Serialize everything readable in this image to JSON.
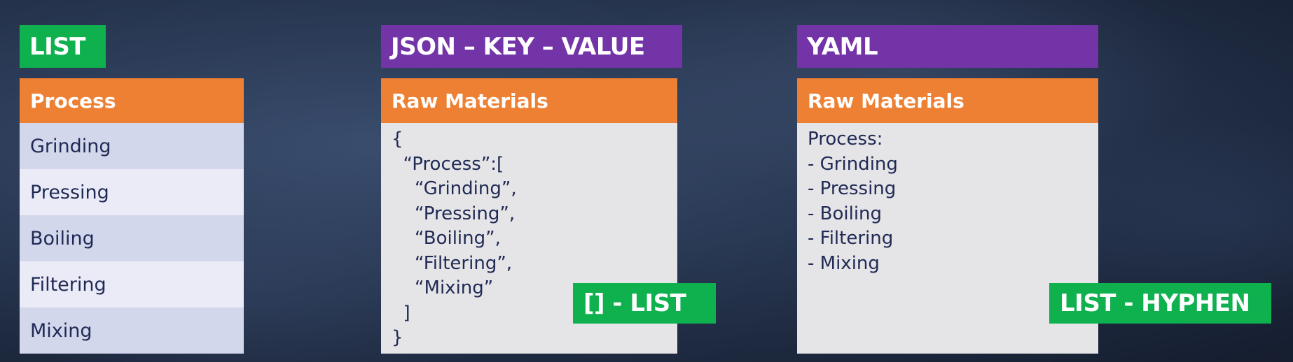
{
  "list_section": {
    "tag": "LIST",
    "header": "Process",
    "items": [
      "Grinding",
      "Pressing",
      "Boiling",
      "Filtering",
      "Mixing"
    ]
  },
  "json_section": {
    "tag": "JSON – KEY – VALUE",
    "header": "Raw Materials",
    "code": "{\n  “Process”:[\n    “Grinding”,\n    “Pressing”,\n    “Boiling”,\n    “Filtering”,\n    “Mixing”\n  ]\n}",
    "badge": "[] - LIST"
  },
  "yaml_section": {
    "tag": "YAML",
    "header": "Raw Materials",
    "code": "Process:\n- Grinding\n- Pressing\n- Boiling\n- Filtering\n- Mixing",
    "badge": "LIST - HYPHEN"
  },
  "colors": {
    "green": "#0fb04e",
    "purple": "#7334a8",
    "orange": "#ee8033",
    "text_dark": "#1f2a55"
  }
}
